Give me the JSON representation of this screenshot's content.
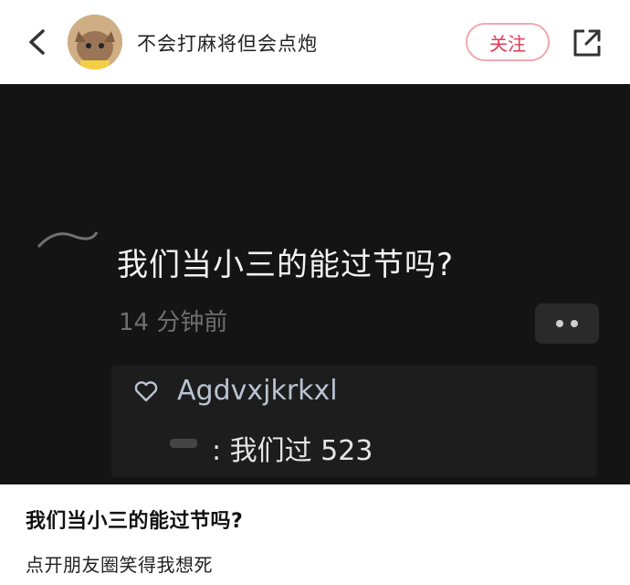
{
  "header": {
    "back_icon": "chevron-left-icon",
    "username": "不会打麻将但会点炮",
    "follow_label": "关注",
    "share_icon": "share-out-icon",
    "accent": "#e23a55"
  },
  "screenshot": {
    "post_title": "我们当小三的能过节吗?",
    "post_time": "14 分钟前",
    "more_icon": "more-dots-icon",
    "comment": {
      "like_icon": "heart-outline-icon",
      "liker_name": "Agdvxjkrkxl",
      "reply_text": ": 我们过 523"
    }
  },
  "caption": {
    "title": "我们当小三的能过节吗?",
    "subtitle": "点开朋友圈笑得我想死"
  }
}
